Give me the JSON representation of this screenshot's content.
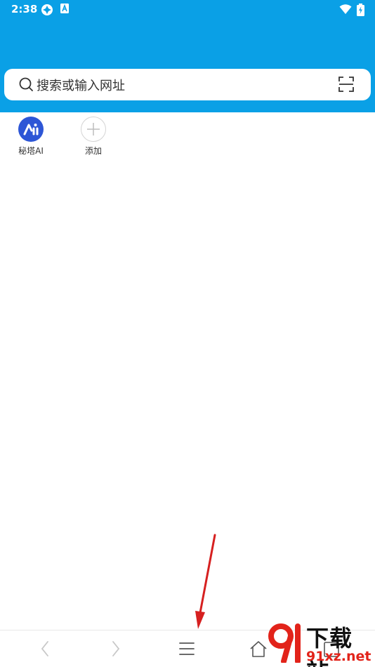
{
  "status_bar": {
    "time": "2:38",
    "icons": [
      "loader-icon",
      "a-notification-icon",
      "wifi-icon",
      "battery-charging-icon"
    ]
  },
  "search": {
    "placeholder": "搜索或输入网址",
    "left_icon": "search-icon",
    "right_icon": "scan-icon"
  },
  "shortcuts": [
    {
      "label": "秘塔AI",
      "icon": "mita-ai-logo"
    },
    {
      "label": "添加",
      "icon": "add-icon"
    }
  ],
  "bottom_nav": {
    "items": [
      "back-icon",
      "forward-icon",
      "menu-icon",
      "home-icon",
      "tabs-icon"
    ]
  },
  "watermark": {
    "title": "下载站",
    "url": "91xz.net"
  },
  "colors": {
    "header": "#0aa0e6",
    "mita_logo": "#2d56d6",
    "arrow": "#d62020"
  }
}
